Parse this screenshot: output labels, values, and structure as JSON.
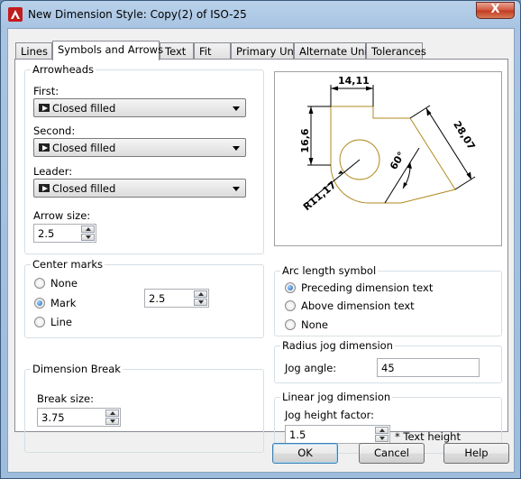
{
  "window": {
    "title": "New Dimension Style: Copy(2) of ISO-25",
    "close_glyph": "X"
  },
  "tabs": [
    {
      "label": "Lines"
    },
    {
      "label": "Symbols and Arrows"
    },
    {
      "label": "Text"
    },
    {
      "label": "Fit"
    },
    {
      "label": "Primary Units"
    },
    {
      "label": "Alternate Units"
    },
    {
      "label": "Tolerances"
    }
  ],
  "arrowheads": {
    "legend": "Arrowheads",
    "first_label": "First:",
    "first_value": "Closed filled",
    "second_label": "Second:",
    "second_value": "Closed filled",
    "leader_label": "Leader:",
    "leader_value": "Closed filled",
    "size_label": "Arrow size:",
    "size_value": "2.5"
  },
  "center_marks": {
    "legend": "Center marks",
    "options": [
      "None",
      "Mark",
      "Line"
    ],
    "selected": "Mark",
    "size_value": "2.5"
  },
  "dimension_break": {
    "legend": "Dimension Break",
    "size_label": "Break size:",
    "size_value": "3.75"
  },
  "preview": {
    "dim_top": "14,11",
    "dim_left": "16,6",
    "dim_right": "28,07",
    "dim_angle": "60°",
    "dim_radius": "R11,17",
    "line_color": "#b08a1e"
  },
  "arc_length": {
    "legend": "Arc length symbol",
    "options": [
      "Preceding dimension text",
      "Above dimension text",
      "None"
    ],
    "selected": "Preceding dimension text"
  },
  "radius_jog": {
    "legend": "Radius jog dimension",
    "angle_label": "Jog angle:",
    "angle_value": "45"
  },
  "linear_jog": {
    "legend": "Linear jog dimension",
    "factor_label": "Jog height factor:",
    "factor_value": "1.5",
    "suffix": "* Text height"
  },
  "buttons": {
    "ok": "OK",
    "cancel": "Cancel",
    "help": "Help"
  }
}
